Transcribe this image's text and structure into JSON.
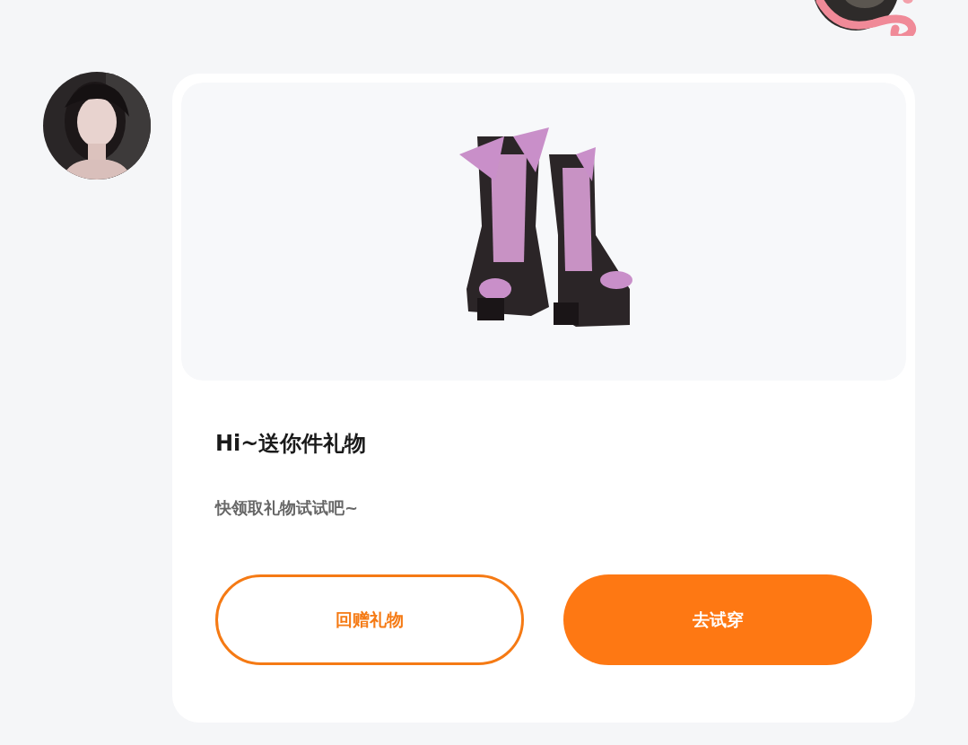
{
  "gift_message": {
    "title": "Hi~送你件礼物",
    "subtitle": "快领取礼物试试吧~",
    "buttons": [
      {
        "label": "回赠礼物",
        "kind": "outline"
      },
      {
        "label": "去试穿",
        "kind": "filled"
      }
    ]
  }
}
